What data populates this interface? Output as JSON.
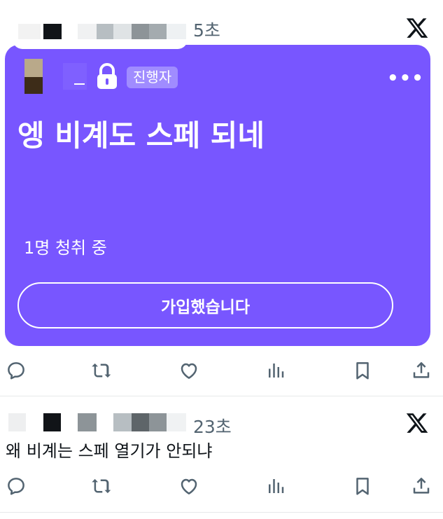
{
  "tweet1": {
    "time": "5초",
    "space": {
      "host_badge": "진행자",
      "more": "•••",
      "title": "엥 비계도 스페 되네",
      "listeners": "1명 청취 중",
      "join_button": "가입했습니다"
    }
  },
  "tweet2": {
    "time": "23초",
    "text": "왜 비계는 스페 열기가 안되냐"
  },
  "icons": [
    "x-logo-icon",
    "reply-icon",
    "retweet-icon",
    "like-icon",
    "views-icon",
    "bookmark-icon",
    "share-icon",
    "lock-icon",
    "more-icon"
  ],
  "colors": {
    "space_purple": "#7856ff",
    "badge": "#a08cff",
    "muted": "#536471"
  }
}
